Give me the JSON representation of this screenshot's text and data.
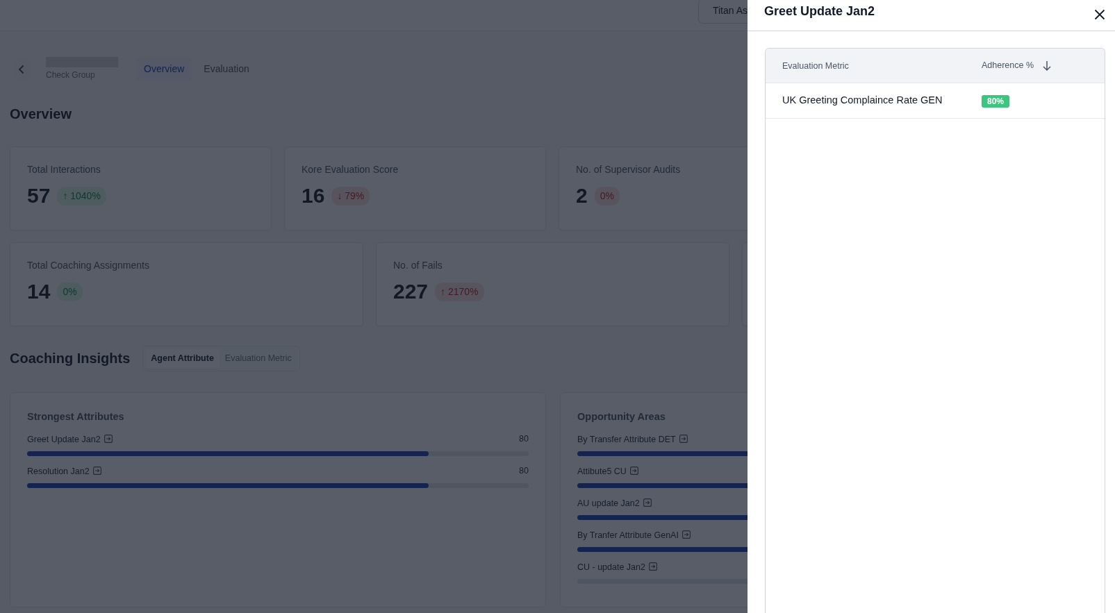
{
  "top_bar": {
    "account_button": "Titan As"
  },
  "header": {
    "subtitle": "Check Group",
    "tabs": [
      {
        "label": "Overview",
        "selected": true
      },
      {
        "label": "Evaluation",
        "selected": false
      }
    ]
  },
  "overview": {
    "title": "Overview",
    "rows": [
      [
        {
          "label": "Total Interactions",
          "value": "57",
          "change": "↑ 1040%",
          "positive": true
        },
        {
          "label": "Kore Evaluation Score",
          "value": "16",
          "change": "↓ 79%",
          "positive": false
        },
        {
          "label": "No. of Supervisor Audits",
          "value": "2",
          "change": "0%",
          "positive": false
        }
      ],
      [
        {
          "label": "Total Coaching Assignments",
          "value": "14",
          "change": "0%",
          "positive": true
        },
        {
          "label": "No. of Fails",
          "value": "227",
          "change": "↑ 2170%",
          "positive": false
        }
      ]
    ]
  },
  "coaching_insights": {
    "title": "Coaching Insights",
    "toggle": [
      {
        "label": "Agent Attribute",
        "selected": true
      },
      {
        "label": "Evaluation Metric",
        "selected": false
      }
    ],
    "panels": [
      {
        "title": "Strongest Attributes",
        "items": [
          {
            "label": "Greet Update Jan2",
            "value": "80",
            "level": 0.8
          },
          {
            "label": "Resolution Jan2",
            "value": "80",
            "level": 0.8
          }
        ]
      },
      {
        "title": "Opportunity Areas",
        "items": [
          {
            "label": "By Transfer Attribute DET",
            "filled": true
          },
          {
            "label": "Attibute5 CU",
            "filled": true
          },
          {
            "label": "AU update Jan2",
            "filled": true
          },
          {
            "label": "By Tranfer Attribute GenAI",
            "filled": true
          },
          {
            "label": "CU - update Jan2",
            "filled": false
          }
        ]
      }
    ]
  },
  "drawer": {
    "title": "Greet Update Jan2",
    "columns": [
      {
        "label": "Evaluation Metric",
        "sorted": false
      },
      {
        "label": "Adherence %",
        "sorted": true
      }
    ],
    "rows": [
      {
        "metric": "UK Greeting Complaince Rate GEN",
        "adherence": "80%"
      }
    ]
  }
}
